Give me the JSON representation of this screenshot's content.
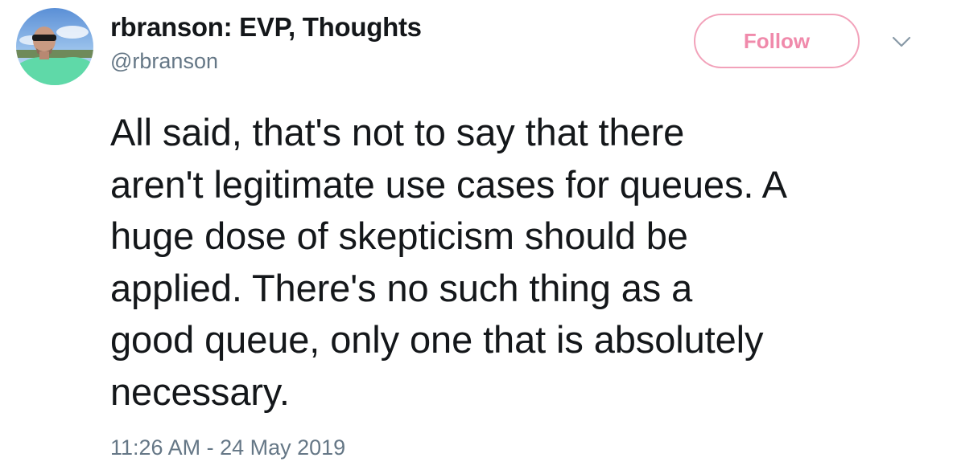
{
  "author": {
    "display_name": "rbranson: EVP, Thoughts",
    "handle": "@rbranson"
  },
  "follow_button": {
    "label": "Follow"
  },
  "menu": {
    "icon": "chevron-down-icon"
  },
  "tweet": {
    "text_lines": [
      "All said, that's not to say that there",
      "aren't legitimate use cases for queues. A",
      "huge dose of skepticism should be",
      "applied. There's no such thing as a",
      "good queue, only one that is absolutely",
      "necessary."
    ],
    "timestamp": "11:26 AM - 24 May 2019"
  },
  "colors": {
    "follow_accent": "#f08aab",
    "secondary_text": "#657786",
    "primary_text": "#14171a"
  }
}
